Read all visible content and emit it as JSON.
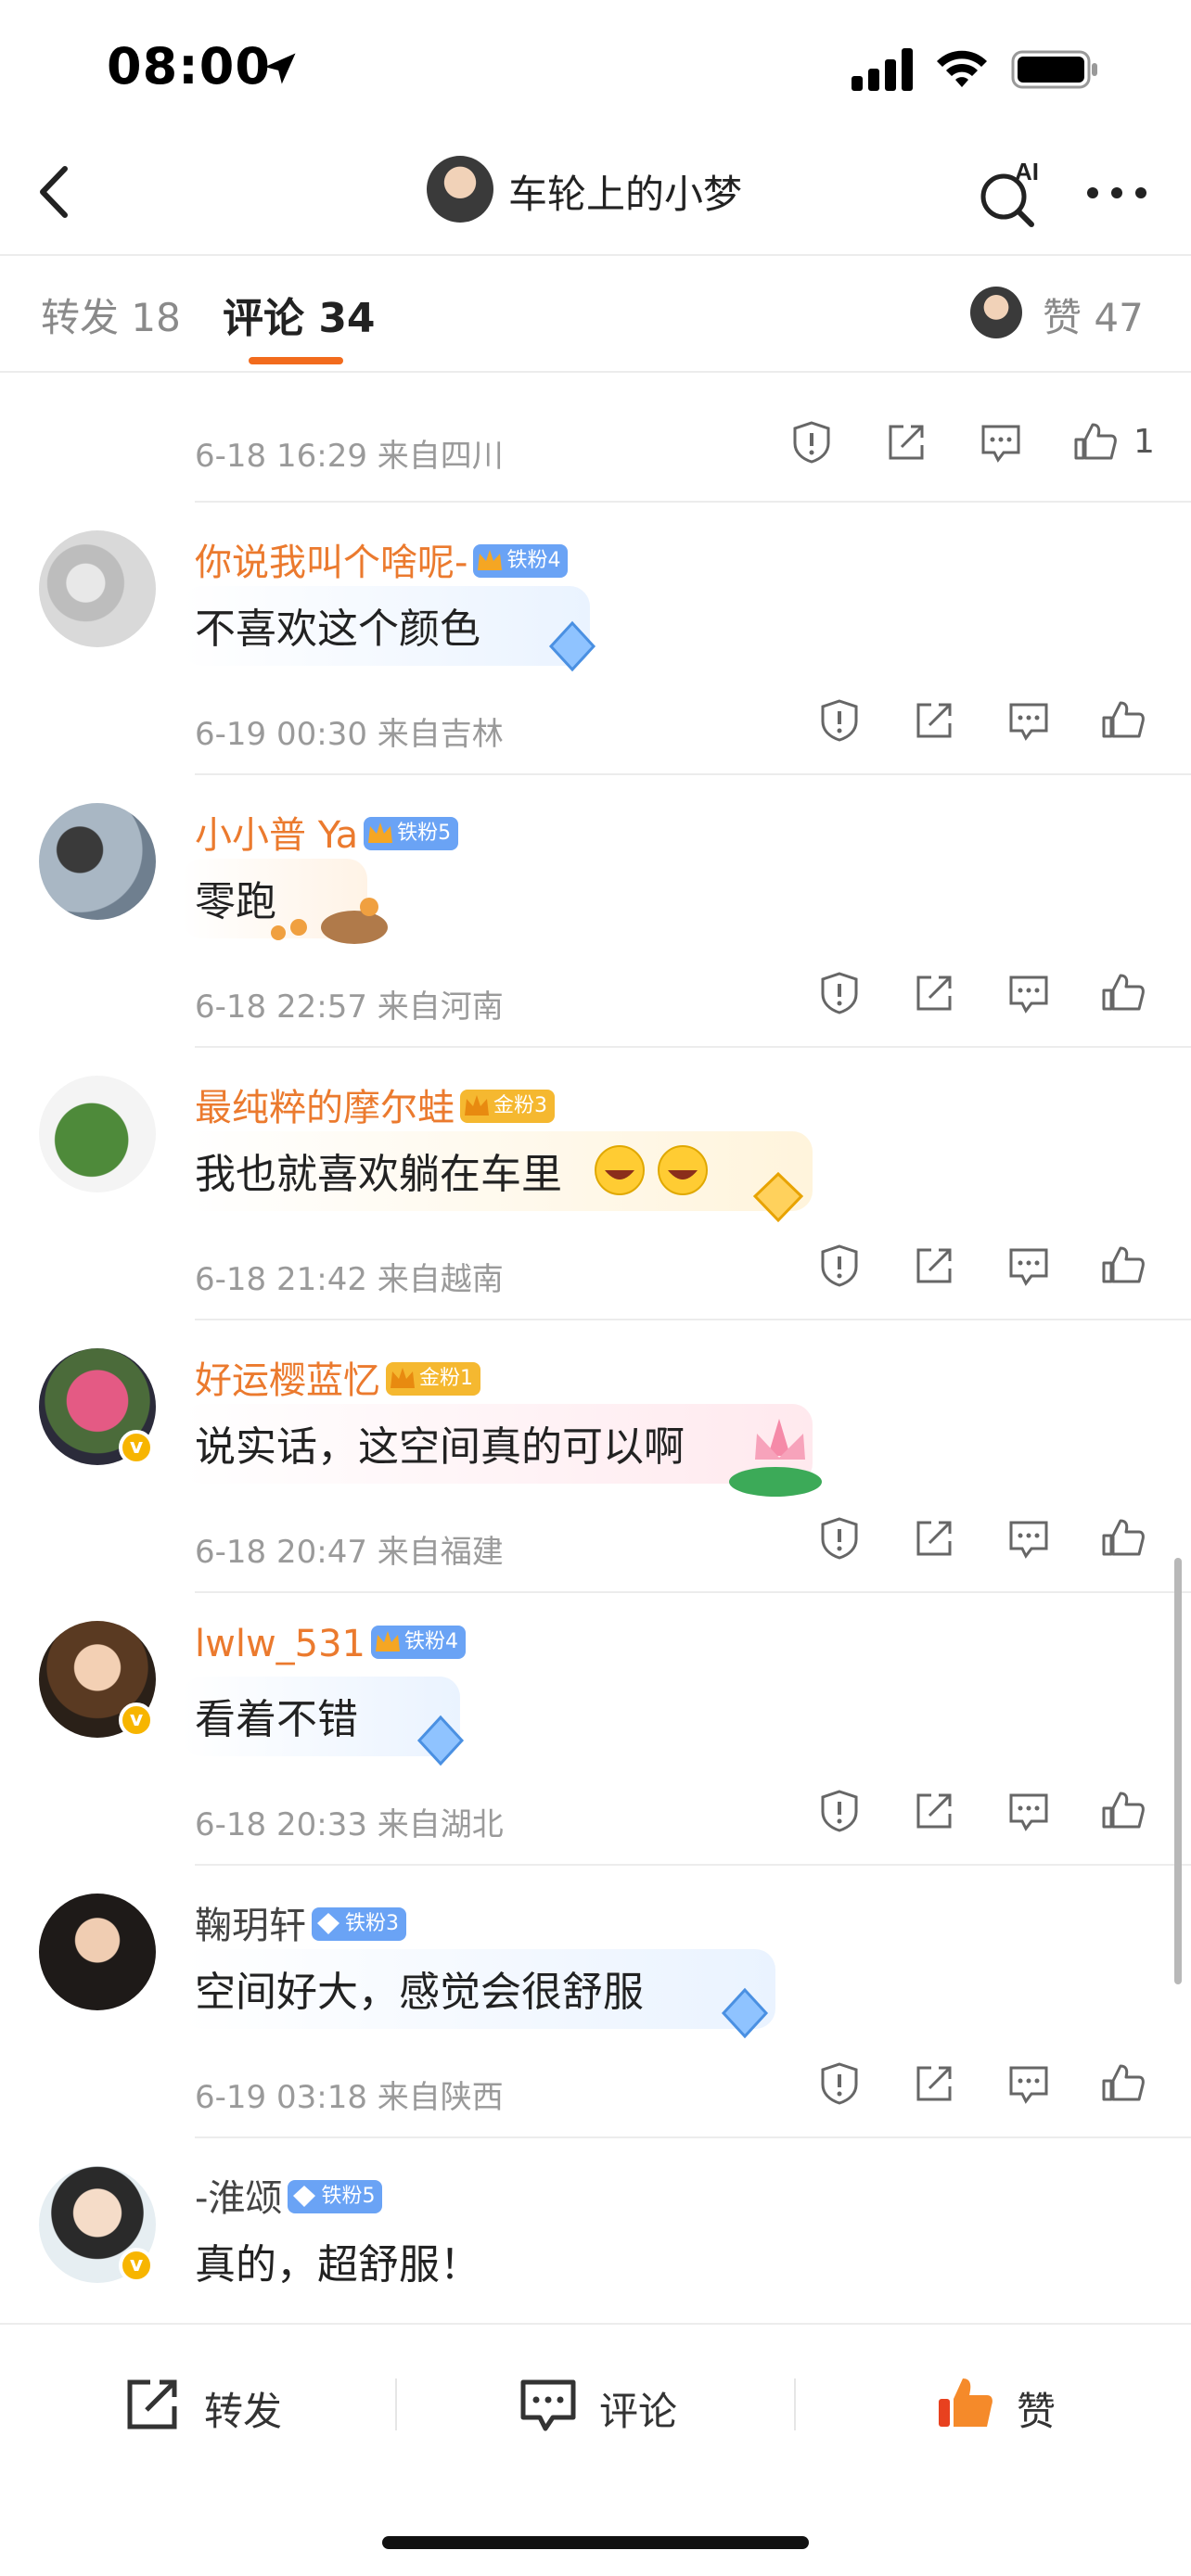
{
  "status_bar": {
    "time": "08:00"
  },
  "nav": {
    "title": "车轮上的小梦"
  },
  "tabs": {
    "repost": "转发 18",
    "comment": "评论 34",
    "like": "赞 47"
  },
  "first_meta": {
    "meta": "6-18 16:29 来自四川",
    "like_count": "1"
  },
  "comments": [
    {
      "name": "你说我叫个啥呢-",
      "badge": "铁粉4",
      "badge_type": "iron",
      "text": "不喜欢这个颜色",
      "meta": "6-19 00:30 来自吉林"
    },
    {
      "name": "小小普 Ya",
      "badge": "铁粉5",
      "badge_type": "iron",
      "text": "零跑",
      "meta": "6-18 22:57 来自河南"
    },
    {
      "name": "最纯粹的摩尔蛙",
      "badge": "金粉3",
      "badge_type": "gold",
      "text": "我也就喜欢躺在车里",
      "meta": "6-18 21:42 来自越南"
    },
    {
      "name": "好运樱蓝忆",
      "badge": "金粉1",
      "badge_type": "gold",
      "text": "说实话，这空间真的可以啊",
      "meta": "6-18 20:47 来自福建"
    },
    {
      "name": "lwlw_531",
      "badge": "铁粉4",
      "badge_type": "iron",
      "text": "看着不错",
      "meta": "6-18 20:33 来自湖北"
    },
    {
      "name": "鞠玥轩",
      "badge": "铁粉3",
      "badge_type": "iron",
      "text": "空间好大，感觉会很舒服",
      "meta": "6-19 03:18 来自陕西"
    },
    {
      "name": "-淮颂",
      "badge": "铁粉5",
      "badge_type": "iron",
      "text": "真的，超舒服！",
      "meta": ""
    }
  ],
  "bottom_bar": {
    "repost": "转发",
    "comment": "评论",
    "like": "赞"
  },
  "colors": {
    "accent": "#f26b1d",
    "name_orange": "#eb7a2e",
    "iron_badge": "#6aa3f5",
    "gold_badge": "#f5b830"
  },
  "icons": [
    "back-icon",
    "ai-search-icon",
    "more-icon",
    "report-icon",
    "share-icon",
    "reply-icon",
    "like-icon"
  ]
}
